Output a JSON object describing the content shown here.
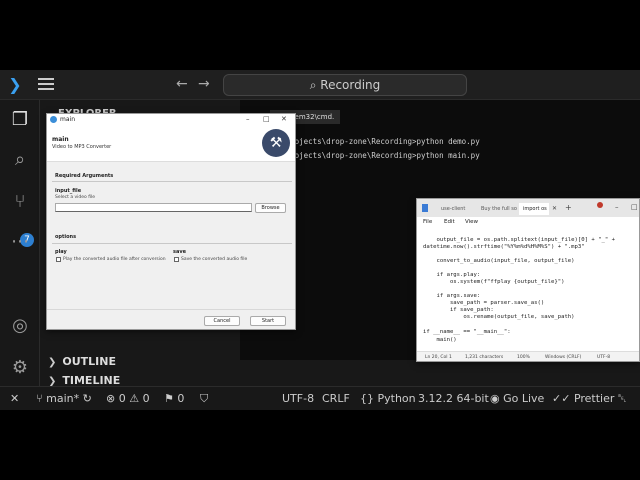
{
  "vscode": {
    "command_center": "Recording",
    "sidebar": {
      "explorer_header": "EXPLORER",
      "sections": [
        "OUTLINE",
        "TIMELINE"
      ]
    },
    "source_control_badge": "7",
    "terminal": {
      "tab_title": "ystem32\\cmd.",
      "lines": [
        "shaprojects\\drop-zone\\Recording>python demo.py",
        "shaprojects\\drop-zone\\Recording>python main.py"
      ]
    },
    "status": {
      "branch": "main*",
      "errors": "0",
      "warnings": "0",
      "ports": "0",
      "encoding": "UTF-8",
      "eol": "CRLF",
      "language": "Python",
      "interpreter": "3.12.2 64-bit",
      "golive": "Go Live",
      "prettier": "Prettier"
    }
  },
  "pywin": {
    "title": "main",
    "header_title": "main",
    "header_subtitle": "Video to MP3 Converter",
    "required_header": "Required Arguments",
    "input_label": "input_file",
    "input_help": "Select a video file",
    "input_value": "",
    "browse_label": "Browse",
    "options_header": "options",
    "play_label": "play",
    "play_help": "Play the converted audio file after conversion",
    "save_label": "save",
    "save_help": "Save the converted audio file",
    "cancel_label": "Cancel",
    "start_label": "Start"
  },
  "notepad": {
    "tabs": [
      "use-client",
      "Buy the full sou",
      "import os"
    ],
    "menu": [
      "File",
      "Edit",
      "View"
    ],
    "code": [
      "    output_file = os.path.splitext(input_file)[0] + \"_\" +",
      "datetime.now().strftime(\"%Y%m%d%H%M%S\") + \".mp3\"",
      "",
      "    convert_to_audio(input_file, output_file)",
      "",
      "    if args.play:",
      "        os.system(f\"ffplay {output_file}\")",
      "",
      "    if args.save:",
      "        save_path = parser.save_as()",
      "        if save_path:",
      "            os.rename(output_file, save_path)",
      "",
      "if __name__ == \"__main__\":",
      "    main()"
    ],
    "status": {
      "position": "Ln 20, Col 1",
      "chars": "1,231 characters",
      "zoom": "100%",
      "eol": "Windows (CRLF)",
      "encoding": "UTF-8"
    }
  }
}
